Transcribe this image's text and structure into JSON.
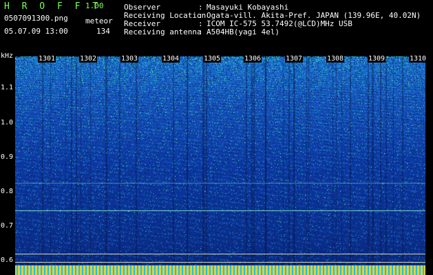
{
  "header": {
    "app_title": "H R O F F T",
    "version": "1.00",
    "filename": "0507091300.png",
    "mode": "meteor",
    "datetime": "05.07.09 13:00",
    "count": "134",
    "fields": [
      {
        "label": "Observer",
        "value": "Masayuki Kobayashi"
      },
      {
        "label": "Receiving Location",
        "value": "Ogata-vill. Akita-Pref. JAPAN (139.96E, 40.02N)"
      },
      {
        "label": "Receiver",
        "value": "ICOM IC-575 53.7492(@LCD)MHz USB"
      },
      {
        "label": "Receiving antenna",
        "value": "A504HB(yagi 4el)"
      }
    ]
  },
  "yaxis": {
    "unit": "kHz",
    "ticks": [
      "1.1",
      "1.0",
      "0.9",
      "0.8",
      "0.7",
      "0.6"
    ]
  },
  "xaxis": {
    "ticks": [
      "1301",
      "1302",
      "1303",
      "1304",
      "1305",
      "1306",
      "1307",
      "1308",
      "1309",
      "1310"
    ]
  },
  "colors": {
    "title": "#7dff5a",
    "spectrum_dark": "#0a2478",
    "spectrum_bright": "#1a6fd0"
  }
}
